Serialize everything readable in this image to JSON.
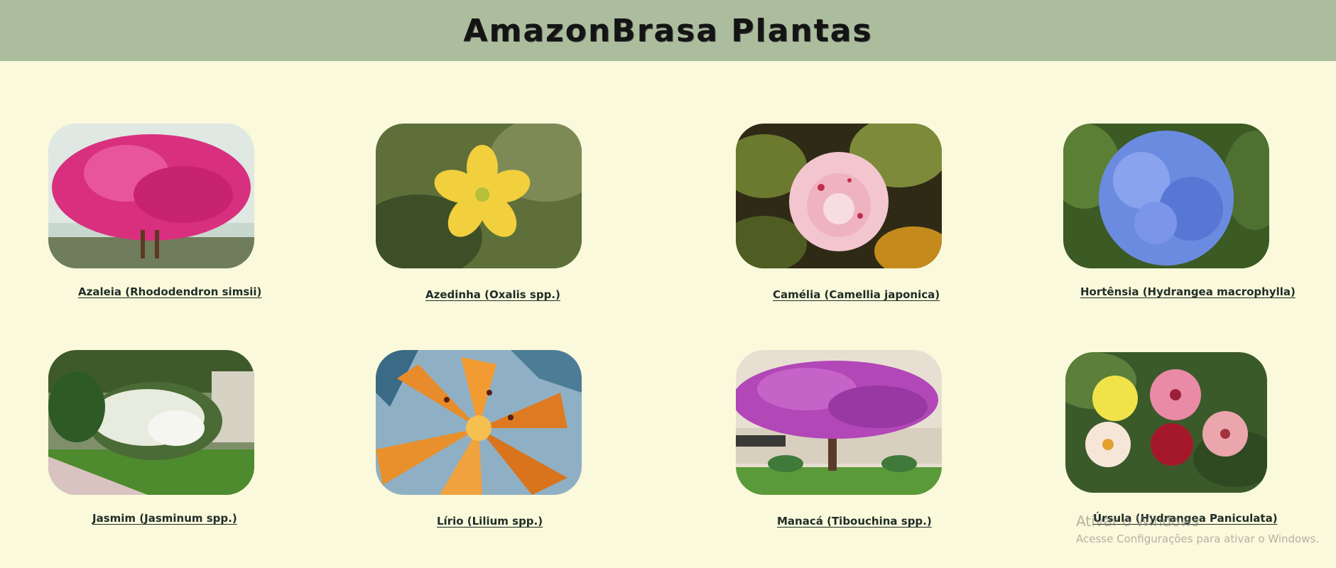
{
  "header": {
    "title": "AmazonBrasa Plantas"
  },
  "plants": [
    {
      "name": "Azaleia (Rhododendron simsii)"
    },
    {
      "name": "Azedinha (Oxalis spp.)"
    },
    {
      "name": "Camélia (Camellia japonica)"
    },
    {
      "name": "Hortênsia (Hydrangea macrophylla)"
    },
    {
      "name": "Jasmim (Jasminum spp.)"
    },
    {
      "name": "Lírio (Lilium spp.)"
    },
    {
      "name": "Manacá (Tibouchina spp.)"
    },
    {
      "name": "Úrsula (Hydrangea Paniculata)"
    }
  ],
  "watermark": {
    "line1": "Ativar o Windows",
    "line2": "Acesse Configurações para ativar o Windows."
  },
  "colors": {
    "header_bg": "#abbd9d",
    "page_bg": "#fbf9db",
    "caption_text": "#1f2d28"
  }
}
